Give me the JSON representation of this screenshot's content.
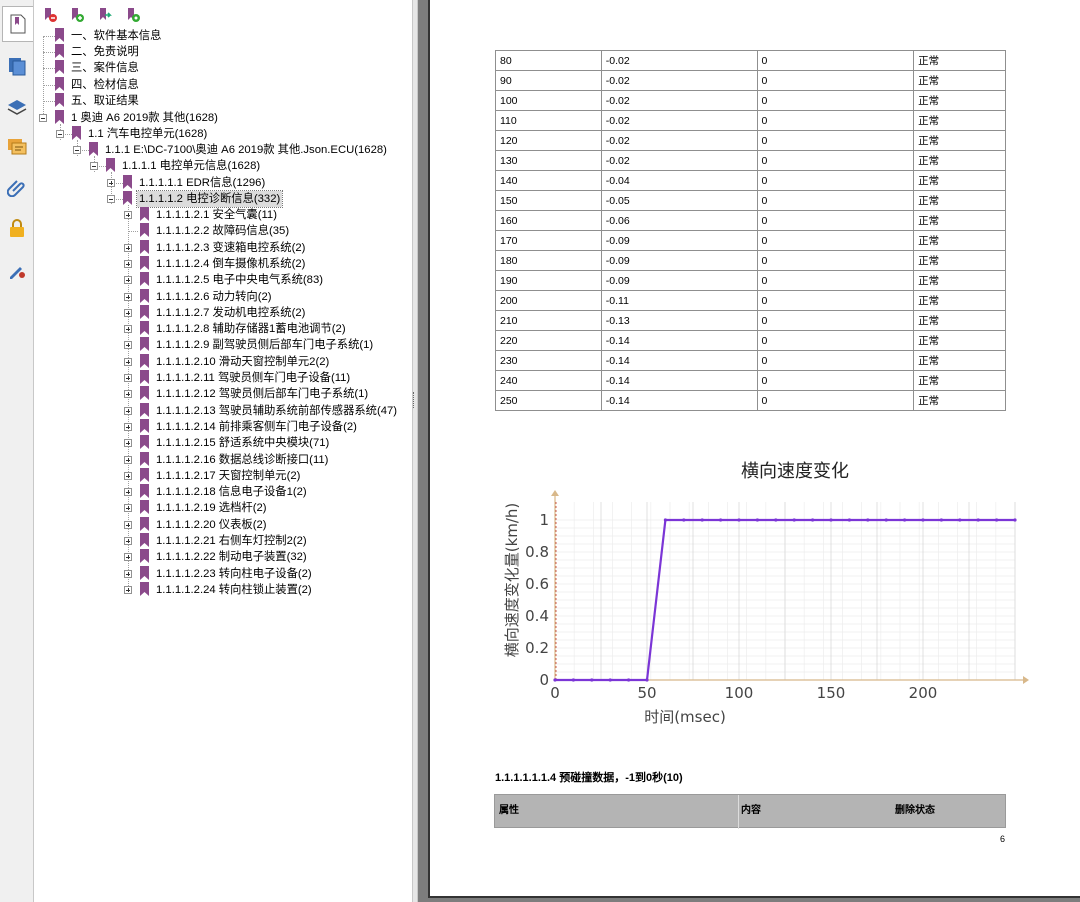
{
  "colors": {
    "bookmark": "#8b4a8b",
    "series_line": "#7b35d6",
    "header_gray": "#b4b4b4"
  },
  "rail": {
    "icons": [
      "bookmarks-icon",
      "pages-icon",
      "layers-icon",
      "comments-icon",
      "attachments-icon",
      "security-icon",
      "signatures-icon"
    ]
  },
  "bookmarks_toolbar": {
    "icons": [
      "bookmark-delete-icon",
      "bookmark-expand-icon",
      "bookmark-goto-icon",
      "bookmark-properties-icon"
    ]
  },
  "tree": [
    {
      "label": "一、软件基本信息"
    },
    {
      "label": "二、免责说明"
    },
    {
      "label": "三、案件信息"
    },
    {
      "label": "四、检材信息"
    },
    {
      "label": "五、取证结果"
    },
    {
      "label": "1 奥迪 A6 2019款 其他(1628)"
    },
    {
      "label": "1.1 汽车电控单元(1628)"
    },
    {
      "label": "1.1.1 E:\\DC-7100\\奥迪 A6 2019款 其他.Json.ECU(1628)"
    },
    {
      "label": "1.1.1.1 电控单元信息(1628)"
    },
    {
      "label": "1.1.1.1.1 EDR信息(1296)"
    },
    {
      "label": "1.1.1.1.2 电控诊断信息(332)"
    },
    {
      "label": "1.1.1.1.2.1 安全气囊(11)"
    },
    {
      "label": "1.1.1.1.2.2 故障码信息(35)"
    },
    {
      "label": "1.1.1.1.2.3 变速箱电控系统(2)"
    },
    {
      "label": "1.1.1.1.2.4 倒车摄像机系统(2)"
    },
    {
      "label": "1.1.1.1.2.5 电子中央电气系统(83)"
    },
    {
      "label": "1.1.1.1.2.6 动力转向(2)"
    },
    {
      "label": "1.1.1.1.2.7 发动机电控系统(2)"
    },
    {
      "label": "1.1.1.1.2.8 辅助存储器1蓄电池调节(2)"
    },
    {
      "label": "1.1.1.1.2.9 副驾驶员侧后部车门电子系统(1)"
    },
    {
      "label": "1.1.1.1.2.10 滑动天窗控制单元2(2)"
    },
    {
      "label": "1.1.1.1.2.11 驾驶员侧车门电子设备(11)"
    },
    {
      "label": "1.1.1.1.2.12 驾驶员侧后部车门电子系统(1)"
    },
    {
      "label": "1.1.1.1.2.13 驾驶员辅助系统前部传感器系统(47)"
    },
    {
      "label": "1.1.1.1.2.14 前排乘客侧车门电子设备(2)"
    },
    {
      "label": "1.1.1.1.2.15 舒适系统中央模块(71)"
    },
    {
      "label": "1.1.1.1.2.16 数据总线诊断接口(11)"
    },
    {
      "label": "1.1.1.1.2.17 天窗控制单元(2)"
    },
    {
      "label": "1.1.1.1.2.18 信息电子设备1(2)"
    },
    {
      "label": "1.1.1.1.2.19 选档杆(2)"
    },
    {
      "label": "1.1.1.1.2.20 仪表板(2)"
    },
    {
      "label": "1.1.1.1.2.21 右侧车灯控制2(2)"
    },
    {
      "label": "1.1.1.1.2.22 制动电子装置(32)"
    },
    {
      "label": "1.1.1.1.2.23 转向柱电子设备(2)"
    },
    {
      "label": "1.1.1.1.2.24 转向柱锁止装置(2)"
    }
  ],
  "data_table": {
    "rows": [
      [
        "80",
        "-0.02",
        "0",
        "正常"
      ],
      [
        "90",
        "-0.02",
        "0",
        "正常"
      ],
      [
        "100",
        "-0.02",
        "0",
        "正常"
      ],
      [
        "110",
        "-0.02",
        "0",
        "正常"
      ],
      [
        "120",
        "-0.02",
        "0",
        "正常"
      ],
      [
        "130",
        "-0.02",
        "0",
        "正常"
      ],
      [
        "140",
        "-0.04",
        "0",
        "正常"
      ],
      [
        "150",
        "-0.05",
        "0",
        "正常"
      ],
      [
        "160",
        "-0.06",
        "0",
        "正常"
      ],
      [
        "170",
        "-0.09",
        "0",
        "正常"
      ],
      [
        "180",
        "-0.09",
        "0",
        "正常"
      ],
      [
        "190",
        "-0.09",
        "0",
        "正常"
      ],
      [
        "200",
        "-0.11",
        "0",
        "正常"
      ],
      [
        "210",
        "-0.13",
        "0",
        "正常"
      ],
      [
        "220",
        "-0.14",
        "0",
        "正常"
      ],
      [
        "230",
        "-0.14",
        "0",
        "正常"
      ],
      [
        "240",
        "-0.14",
        "0",
        "正常"
      ],
      [
        "250",
        "-0.14",
        "0",
        "正常"
      ]
    ]
  },
  "chart_data": {
    "type": "line",
    "title": "横向速度变化",
    "xlabel": "时间(msec)",
    "ylabel": "横向速度变化量(km/h)",
    "xlim": [
      0,
      250
    ],
    "ylim": [
      0,
      1
    ],
    "xticks": [
      "0",
      "50",
      "100",
      "150",
      "200"
    ],
    "yticks": [
      "0",
      "0.2",
      "0.4",
      "0.6",
      "0.8",
      "1"
    ],
    "grid": true,
    "series": [
      {
        "x": [
          0,
          10,
          20,
          30,
          40,
          50,
          60,
          70,
          80,
          90,
          100,
          110,
          120,
          130,
          140,
          150,
          160,
          170,
          180,
          190,
          200,
          210,
          220,
          230,
          240,
          250
        ],
        "y": [
          0,
          0,
          0,
          0,
          0,
          0,
          1,
          1,
          1,
          1,
          1,
          1,
          1,
          1,
          1,
          1,
          1,
          1,
          1,
          1,
          1,
          1,
          1,
          1,
          1,
          1
        ]
      }
    ]
  },
  "section": {
    "title": "1.1.1.1.1.1.4 预碰撞数据，-1到0秒(10)"
  },
  "attr_table": {
    "col1": "属性",
    "col2": "内容",
    "col3": "删除状态"
  },
  "page_number": "6"
}
